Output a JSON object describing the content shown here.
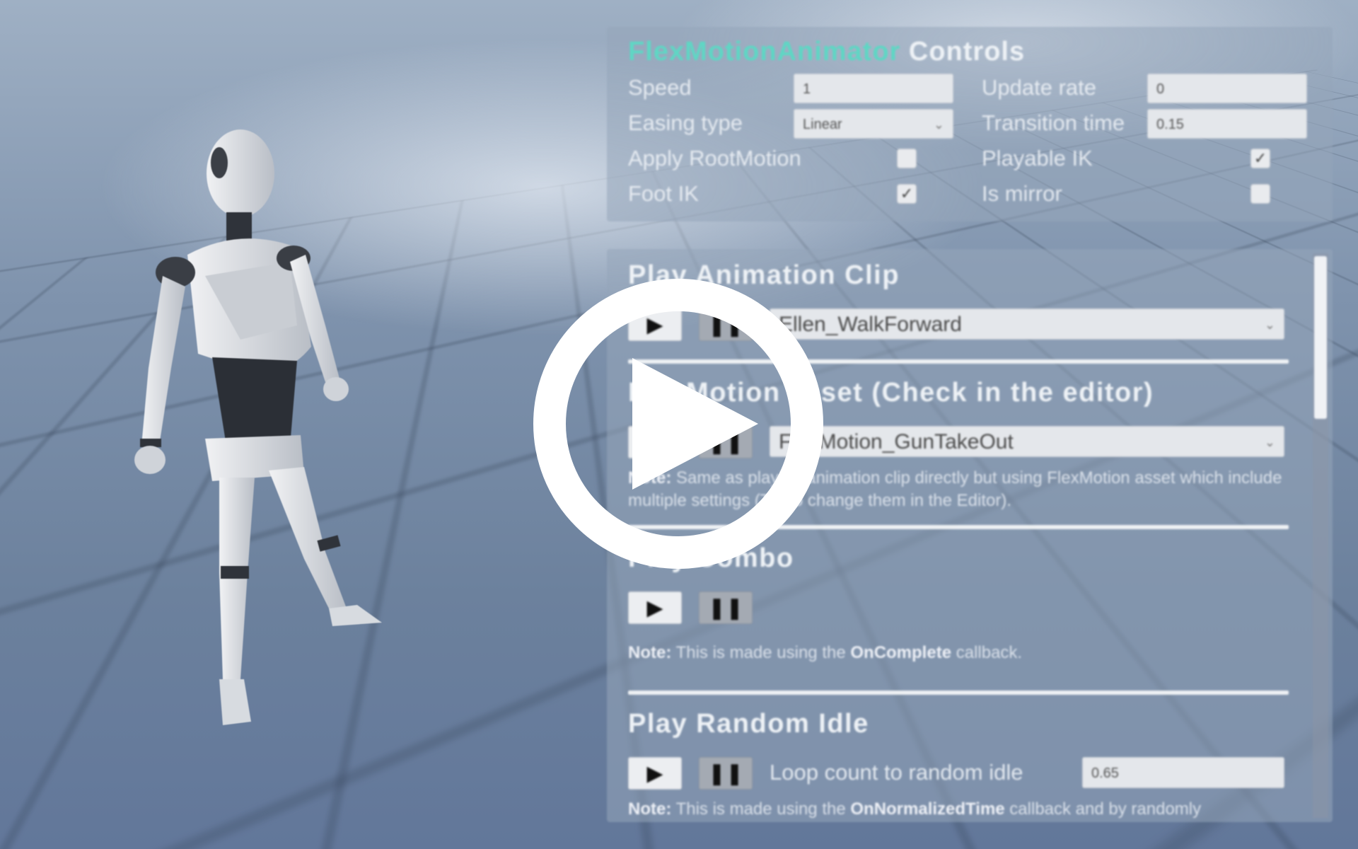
{
  "controls": {
    "title_accent": "FlexMotionAnimator",
    "title_rest": "Controls",
    "speed_label": "Speed",
    "speed_value": "1",
    "update_rate_label": "Update rate",
    "update_rate_value": "0",
    "easing_label": "Easing type",
    "easing_value": "Linear",
    "transition_label": "Transition time",
    "transition_value": "0.15",
    "apply_root_motion_label": "Apply RootMotion",
    "apply_root_motion_checked": false,
    "playable_ik_label": "Playable IK",
    "playable_ik_checked": true,
    "foot_ik_label": "Foot IK",
    "foot_ik_checked": true,
    "is_mirror_label": "Is mirror",
    "is_mirror_checked": false,
    "check_glyph": "✓"
  },
  "sections": {
    "play_clip_title": "Play Animation Clip",
    "play_clip_selected": "Ellen_WalkForward",
    "flexmotion_title": "FlexMotion asset (Check in the editor)",
    "flexmotion_selected": "FlexMotion_GunTakeOut",
    "flexmotion_note_label": "Note:",
    "flexmotion_note_text": " Same as playing animation clip directly but using FlexMotion asset which include multiple settings (Try to change them in the Editor).",
    "combo_title": "Play Combo",
    "combo_note_label": "Note:",
    "combo_note_pre": " This is made using the ",
    "combo_note_bold": "OnComplete",
    "combo_note_post": " callback.",
    "idle_title": "Play Random Idle",
    "idle_loop_label": "Loop count to random idle",
    "idle_loop_value": "0.65",
    "idle_note_label": "Note:",
    "idle_note_pre": " This is made using the ",
    "idle_note_bold": "OnNormalizedTime",
    "idle_note_post": " callback and by randomly"
  },
  "buttons": {
    "play_glyph": "▶",
    "pause_glyph": "❚❚",
    "chevron_glyph": "⌄"
  },
  "colors": {
    "accent": "#5fd6c4",
    "panel": "#96a5b9",
    "overlay": "#ffffff"
  },
  "icons": {
    "overlay": "play-circle-icon"
  }
}
